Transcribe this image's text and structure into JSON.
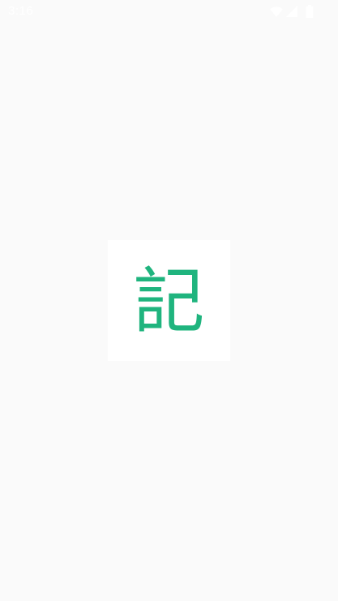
{
  "status_bar": {
    "time": "3:16",
    "icons": [
      "wifi-icon",
      "cell-signal-icon",
      "battery-icon"
    ],
    "icon_color": "#ffffff"
  },
  "splash": {
    "logo_char": "記",
    "logo_color": "#1fb47e",
    "card_color": "#ffffff"
  },
  "colors": {
    "background": "#fafafa"
  }
}
